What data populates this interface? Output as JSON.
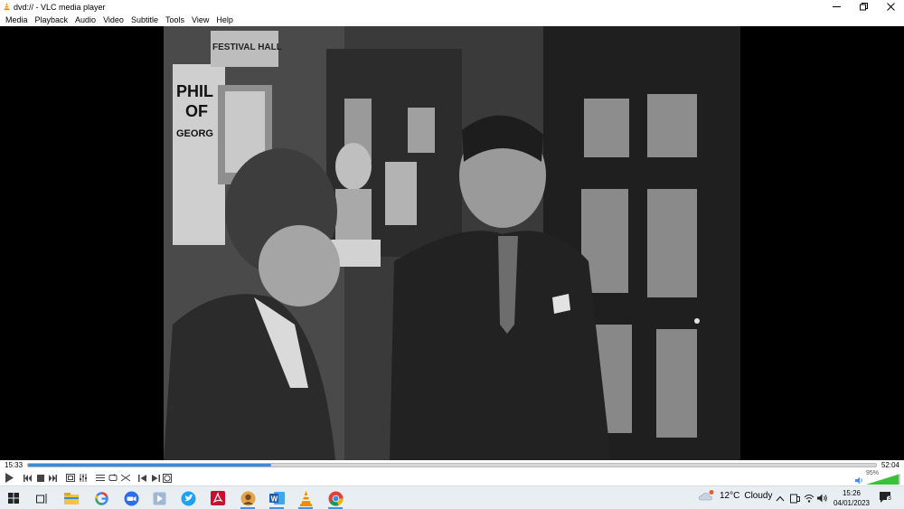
{
  "window": {
    "title": "dvd:// - VLC media player",
    "icon": "vlc-cone-icon"
  },
  "menu": [
    "Media",
    "Playback",
    "Audio",
    "Video",
    "Subtitle",
    "Tools",
    "View",
    "Help"
  ],
  "video": {
    "poster_text": {
      "festival": "FESTIVAL HALL",
      "phil": "PHIL",
      "of": "OF",
      "georg": "GEORG"
    }
  },
  "playback": {
    "current_time": "15:33",
    "total_time": "52:04",
    "progress": 0.287
  },
  "volume": {
    "level_text": "95%",
    "level": 0.95
  },
  "taskbar": {
    "weather_temp": "12°C",
    "weather_desc": "Cloudy",
    "time": "15:26",
    "date": "04/01/2023",
    "notification_count": "3",
    "apps": [
      "windows-start-icon",
      "task-view-icon",
      "file-explorer-icon",
      "google-icon",
      "zoom-icon",
      "media-app-icon",
      "twitter-icon",
      "acrobat-icon",
      "user-app-icon",
      "word-icon",
      "vlc-icon",
      "chrome-icon"
    ]
  },
  "colors": {
    "seek_fill": "#3c8bd9",
    "vlc_orange": "#f08a00",
    "volume_green": "#37c237"
  }
}
